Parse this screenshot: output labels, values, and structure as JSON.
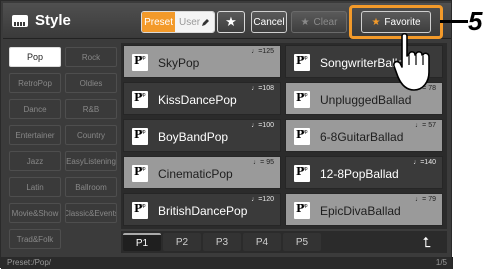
{
  "header": {
    "title": "Style",
    "tab_preset": "Preset",
    "tab_user": "User",
    "star": "★",
    "cancel": "Cancel",
    "clear": "Clear",
    "favorite": "Favorite"
  },
  "categories": [
    "Pop",
    "Rock",
    "RetroPop",
    "Oldies",
    "Dance",
    "R&B",
    "Entertainer",
    "Country",
    "Jazz",
    "EasyListening",
    "Latin",
    "Ballroom",
    "Movie&Show",
    "Classic&Events",
    "Trad&Folk"
  ],
  "active_category": "Pop",
  "styles": [
    {
      "name": "SkyPop",
      "tempo": "♩=125",
      "light": true
    },
    {
      "name": "SongwriterBallad",
      "tempo": "",
      "light": false
    },
    {
      "name": "KissDancePop",
      "tempo": "♩=108",
      "light": false
    },
    {
      "name": "UnpluggedBallad",
      "tempo": "♩= 78",
      "light": true
    },
    {
      "name": "BoyBandPop",
      "tempo": "♩=100",
      "light": false
    },
    {
      "name": "6-8GuitarBallad",
      "tempo": "♩= 57",
      "light": true
    },
    {
      "name": "CinematicPop",
      "tempo": "♩= 95",
      "light": true
    },
    {
      "name": "12-8PopBallad",
      "tempo": "♩=140",
      "light": false
    },
    {
      "name": "BritishDancePop",
      "tempo": "♩=120",
      "light": false
    },
    {
      "name": "EpicDivaBallad",
      "tempo": "♩= 79",
      "light": true
    }
  ],
  "pages": [
    "P1",
    "P2",
    "P3",
    "P4",
    "P5"
  ],
  "active_page": "P1",
  "status": {
    "path": "Preset:/Pop/",
    "page_count": "1/5"
  },
  "step_number": "5",
  "colors": {
    "accent": "#f39a2a",
    "background": "#3b3b3b",
    "cell_light": "#9a9a9a"
  }
}
